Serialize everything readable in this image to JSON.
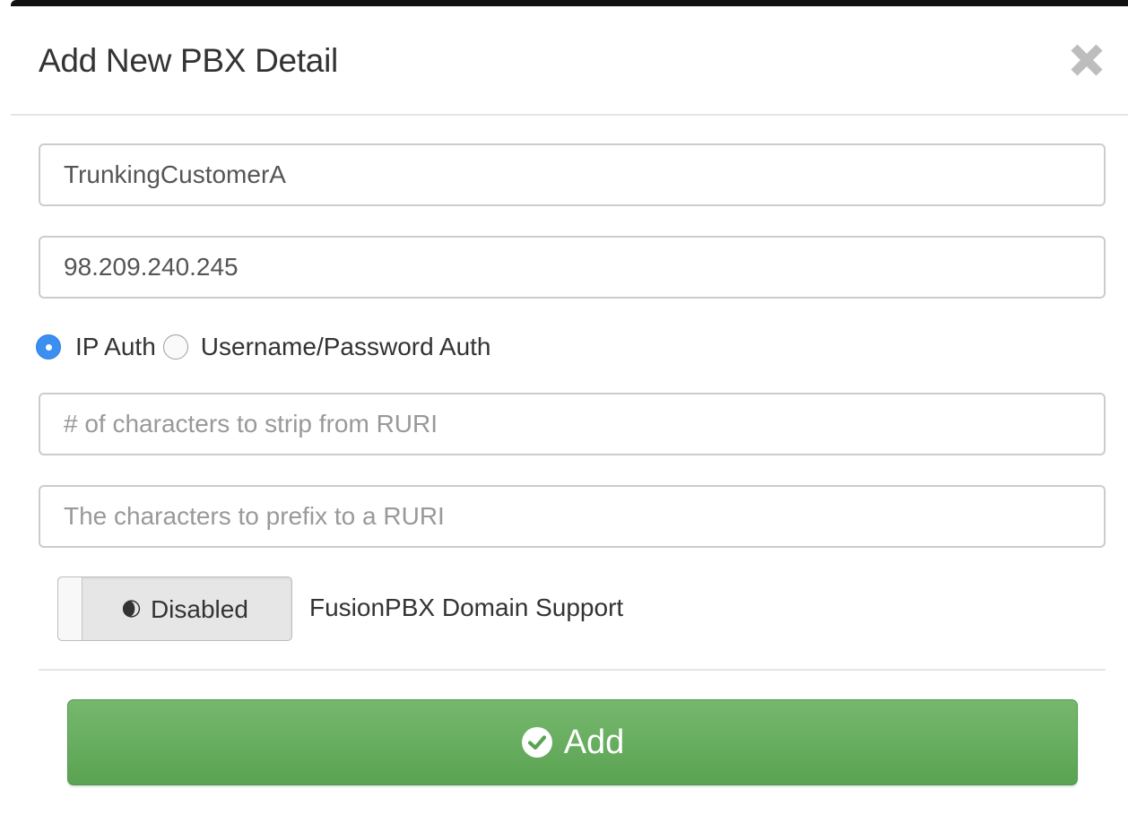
{
  "modal": {
    "title": "Add New PBX Detail",
    "close_icon": "close-icon"
  },
  "fields": {
    "name": {
      "value": "TrunkingCustomerA",
      "placeholder": ""
    },
    "ip": {
      "value": "98.209.240.245",
      "placeholder": ""
    },
    "strip": {
      "value": "",
      "placeholder": "# of characters to strip from RURI"
    },
    "prefix": {
      "value": "",
      "placeholder": "The characters to prefix to a RURI"
    }
  },
  "auth": {
    "options": [
      {
        "label": "IP Auth",
        "checked": true
      },
      {
        "label": "Username/Password Auth",
        "checked": false
      }
    ]
  },
  "fusionpbx": {
    "toggle_state_label": "Disabled",
    "toggle_on": false,
    "caption": "FusionPBX Domain Support"
  },
  "actions": {
    "add_label": "Add",
    "add_icon": "check-circle-icon"
  },
  "colors": {
    "accent_blue": "#3b8ff0",
    "add_green": "#5cb85c"
  }
}
